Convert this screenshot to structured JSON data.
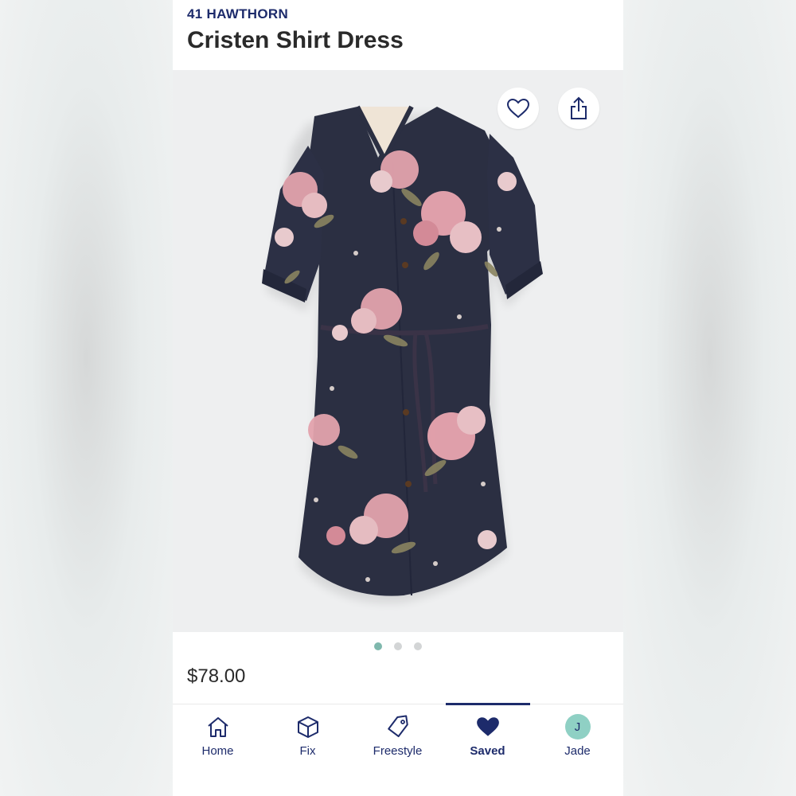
{
  "product": {
    "brand": "41 HAWTHORN",
    "name": "Cristen Shirt Dress",
    "price": "$78.00"
  },
  "actions": {
    "favorite_icon": "heart-outline-icon",
    "share_icon": "share-icon"
  },
  "carousel": {
    "total": 3,
    "active_index": 0
  },
  "nav": {
    "items": [
      {
        "label": "Home",
        "icon": "home-icon"
      },
      {
        "label": "Fix",
        "icon": "box-icon"
      },
      {
        "label": "Freestyle",
        "icon": "tag-icon"
      },
      {
        "label": "Saved",
        "icon": "heart-filled-icon",
        "active": true
      },
      {
        "label": "Jade",
        "icon": "avatar",
        "initial": "J"
      }
    ]
  },
  "colors": {
    "brand_navy": "#1d2b6b",
    "accent_teal": "#8fd0c4",
    "dress_navy": "#2b2f42",
    "floral_pink": "#e3a3ad"
  }
}
